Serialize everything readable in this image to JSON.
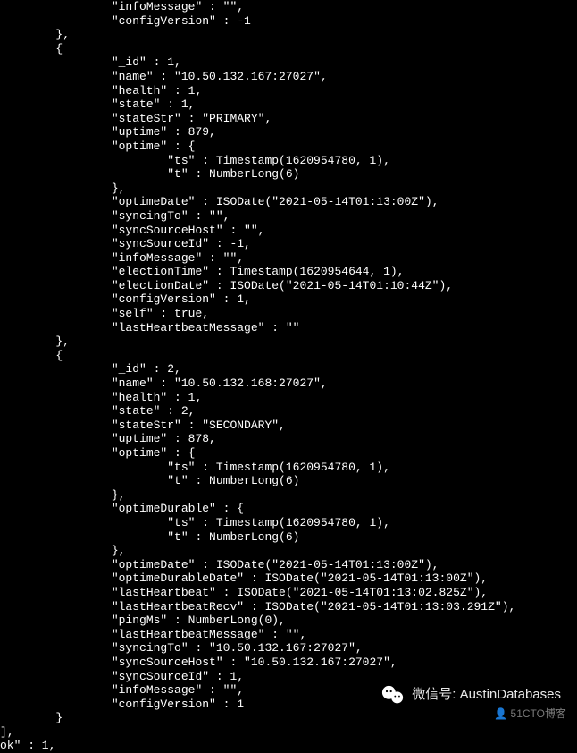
{
  "header": {
    "infoMessage_label": "\"infoMessage\" : \"\",",
    "configVersion_label": "\"configVersion\" : -1"
  },
  "member1": {
    "id": "\"_id\" : 1,",
    "name": "\"name\" : \"10.50.132.167:27027\",",
    "health": "\"health\" : 1,",
    "state": "\"state\" : 1,",
    "stateStr": "\"stateStr\" : \"PRIMARY\",",
    "uptime": "\"uptime\" : 879,",
    "optime_open": "\"optime\" : {",
    "optime_ts": "\"ts\" : Timestamp(1620954780, 1),",
    "optime_t": "\"t\" : NumberLong(6)",
    "close": "},",
    "optimeDate": "\"optimeDate\" : ISODate(\"2021-05-14T01:13:00Z\"),",
    "syncingTo": "\"syncingTo\" : \"\",",
    "syncSourceHost": "\"syncSourceHost\" : \"\",",
    "syncSourceId": "\"syncSourceId\" : -1,",
    "infoMessage": "\"infoMessage\" : \"\",",
    "electionTime": "\"electionTime\" : Timestamp(1620954644, 1),",
    "electionDate": "\"electionDate\" : ISODate(\"2021-05-14T01:10:44Z\"),",
    "configVersion": "\"configVersion\" : 1,",
    "self": "\"self\" : true,",
    "lastHeartbeatMessage": "\"lastHeartbeatMessage\" : \"\""
  },
  "member2": {
    "id": "\"_id\" : 2,",
    "name": "\"name\" : \"10.50.132.168:27027\",",
    "health": "\"health\" : 1,",
    "state": "\"state\" : 2,",
    "stateStr": "\"stateStr\" : \"SECONDARY\",",
    "uptime": "\"uptime\" : 878,",
    "optime_open": "\"optime\" : {",
    "optime_ts": "\"ts\" : Timestamp(1620954780, 1),",
    "optime_t": "\"t\" : NumberLong(6)",
    "close": "},",
    "optimeDurable_open": "\"optimeDurable\" : {",
    "optimeDurable_ts": "\"ts\" : Timestamp(1620954780, 1),",
    "optimeDurable_t": "\"t\" : NumberLong(6)",
    "close2": "},",
    "optimeDate": "\"optimeDate\" : ISODate(\"2021-05-14T01:13:00Z\"),",
    "optimeDurableDate": "\"optimeDurableDate\" : ISODate(\"2021-05-14T01:13:00Z\"),",
    "lastHeartbeat": "\"lastHeartbeat\" : ISODate(\"2021-05-14T01:13:02.825Z\"),",
    "lastHeartbeatRecv": "\"lastHeartbeatRecv\" : ISODate(\"2021-05-14T01:13:03.291Z\"),",
    "pingMs": "\"pingMs\" : NumberLong(0),",
    "lastHeartbeatMessage": "\"lastHeartbeatMessage\" : \"\",",
    "syncingTo": "\"syncingTo\" : \"10.50.132.167:27027\",",
    "syncSourceHost": "\"syncSourceHost\" : \"10.50.132.167:27027\",",
    "syncSourceId": "\"syncSourceId\" : 1,",
    "infoMessage": "\"infoMessage\" : \"\",",
    "configVersion": "\"configVersion\" : 1"
  },
  "closing": {
    "brace": "}",
    "bracket": "],",
    "ok": "ok\" : 1,"
  },
  "watermark": {
    "label": "微信号: AustinDatabases"
  },
  "attribution": {
    "label": "51CTO博客"
  }
}
